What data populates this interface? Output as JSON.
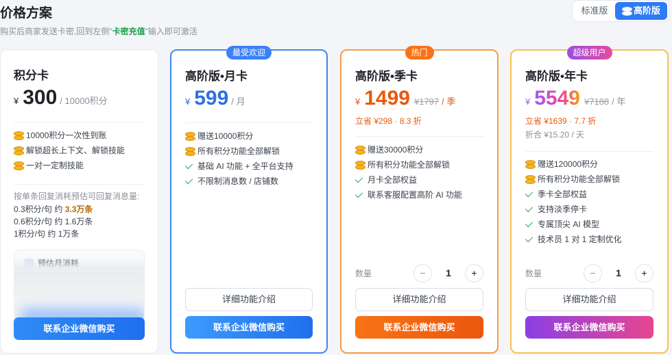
{
  "header": {
    "title": "价格方案",
    "subtitle_pre": "购买后商家发送卡密,回到左侧\"",
    "subtitle_highlight": "卡密充值",
    "subtitle_post": "\"输入即可激活",
    "tab_standard": "标准版",
    "tab_advanced": "高阶版"
  },
  "plans": [
    {
      "name": "积分卡",
      "currency": "¥",
      "price": "300",
      "unit": "/ 10000积分",
      "features": [
        "10000积分一次性到账",
        "解锁超长上下文、解锁技能",
        "一对一定制技能"
      ],
      "calc_header": "按单条回复消耗预估可回复消息量:",
      "calc_rows": [
        {
          "pre": "0.3积分/句 约 ",
          "bold": "3.3万条"
        },
        {
          "pre": "0.6积分/句 约 1.6万条",
          "bold": ""
        },
        {
          "pre": "1积分/句 约 1万条",
          "bold": ""
        }
      ],
      "estimate_title": "预估月消耗",
      "buy_label": "联系企业微信购买"
    },
    {
      "badge": "最受欢迎",
      "name": "高阶版•月卡",
      "currency": "¥",
      "price": "599",
      "unit": "/ 月",
      "features": [
        "赠送10000积分",
        "所有积分功能全部解锁",
        "基础 AI 功能 + 全平台支持",
        "不限制消息数 / 店铺数"
      ],
      "detail_label": "详细功能介绍",
      "buy_label": "联系企业微信购买"
    },
    {
      "badge": "热门",
      "name": "高阶版•季卡",
      "currency": "¥",
      "price": "1499",
      "original_price": "¥1797",
      "unit": "/ 季",
      "savings": "立省 ¥298 · 8.3 折",
      "features": [
        "赠送30000积分",
        "所有积分功能全部解锁",
        "月卡全部权益",
        "联系客服配置高阶 AI 功能"
      ],
      "qty_label": "数量",
      "qty_minus": "−",
      "qty_value": "1",
      "qty_plus": "+",
      "detail_label": "详细功能介绍",
      "buy_label": "联系企业微信购买"
    },
    {
      "badge": "超级用户",
      "name": "高阶版•年卡",
      "currency": "¥",
      "price": "5549",
      "original_price": "¥7188",
      "unit": "/ 年",
      "savings": "立省 ¥1639 · 7.7 折",
      "per_day": "折合 ¥15.20 / 天",
      "features": [
        "赠送120000积分",
        "所有积分功能全部解锁",
        "季卡全部权益",
        "支持淡季停卡",
        "专属顶尖 AI 模型",
        "技术员 1 对 1 定制优化"
      ],
      "qty_label": "数量",
      "qty_minus": "−",
      "qty_value": "1",
      "qty_plus": "+",
      "detail_label": "详细功能介绍",
      "buy_label": "联系企业微信购买"
    }
  ],
  "colors": {
    "accent_blue": "#2f7bf5",
    "accent_orange": "#ea580c",
    "accent_purple": "#a855f7",
    "check_green": "#22a550"
  }
}
